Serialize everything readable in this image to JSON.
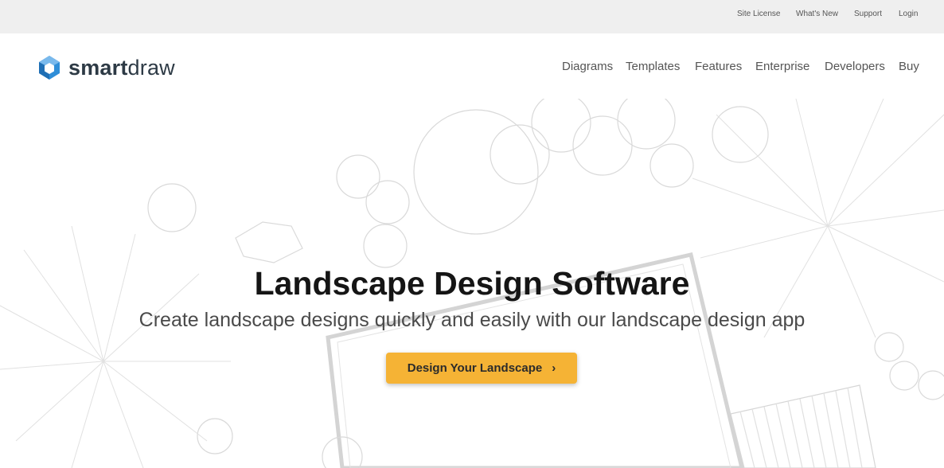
{
  "topbar": {
    "links": [
      "Site License",
      "What's New",
      "Support",
      "Login"
    ]
  },
  "header": {
    "logo": {
      "brand_bold": "smart",
      "brand_light": "draw"
    },
    "nav": [
      "Diagrams",
      "Templates",
      "Features",
      "Enterprise",
      "Developers",
      "Buy"
    ]
  },
  "hero": {
    "title": "Landscape Design Software",
    "subtitle": "Create landscape designs quickly and easily with our landscape design app",
    "cta_label": "Design Your Landscape",
    "cta_chevron": "›"
  },
  "colors": {
    "cta_background": "#f5b335",
    "topbar_background": "#efefef",
    "logo_blue": "#2f8ed8"
  }
}
